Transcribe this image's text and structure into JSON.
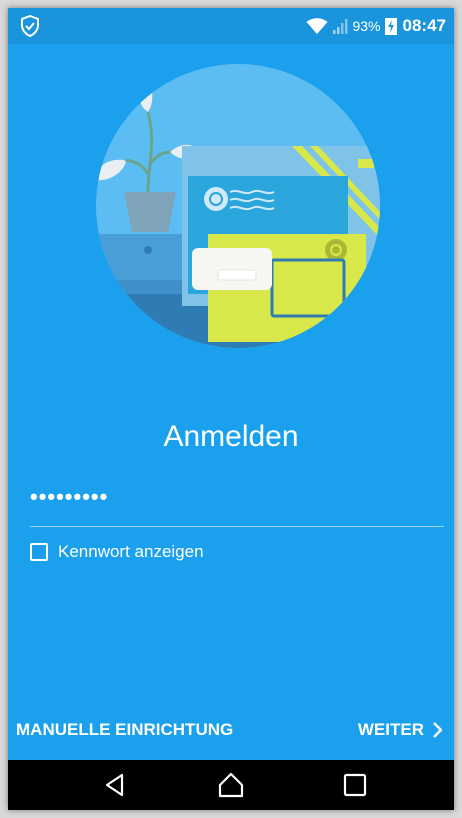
{
  "status_bar": {
    "battery_percent": "93%",
    "time": "08:47",
    "icons": [
      "shield-check-icon",
      "wifi-icon",
      "signal-icon",
      "battery-charging-icon"
    ]
  },
  "login": {
    "title": "Anmelden",
    "password_value": "•••••••••",
    "show_password_label": "Kennwort anzeigen",
    "show_password_checked": false
  },
  "actions": {
    "manual_setup_label": "MANUELLE EINRICHTUNG",
    "next_label": "WEITER"
  },
  "nav_bar": {
    "icons": [
      "back-icon",
      "home-icon",
      "recents-icon"
    ]
  },
  "colors": {
    "background": "#1aa0ec",
    "status_bar": "#1a94dc",
    "nav_bar": "#000000",
    "text": "#ffffff"
  }
}
